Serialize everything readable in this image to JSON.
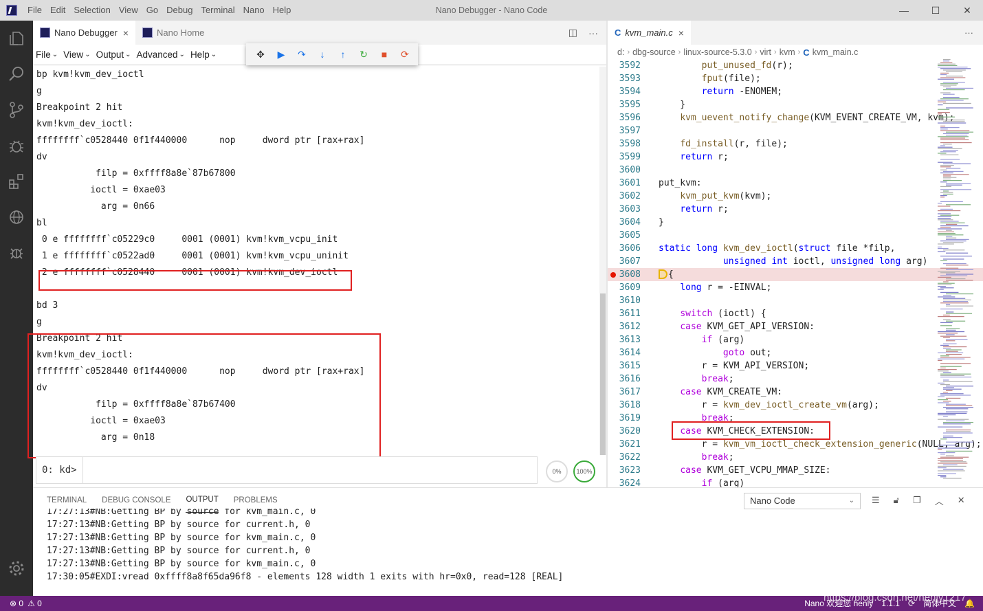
{
  "window": {
    "title": "Nano Debugger - Nano Code",
    "menus": [
      "File",
      "Edit",
      "Selection",
      "View",
      "Go",
      "Debug",
      "Terminal",
      "Nano",
      "Help"
    ]
  },
  "left_editor": {
    "tabs": [
      {
        "label": "Nano Debugger",
        "close": "×"
      },
      {
        "label": "Nano Home"
      }
    ],
    "actions": {
      "split": "◫",
      "more": "···"
    },
    "menu": [
      "File",
      "View",
      "Output",
      "Advanced",
      "Help"
    ],
    "debug_toolbar": [
      {
        "name": "drag",
        "glyph": "✥",
        "color": "#333333"
      },
      {
        "name": "continue",
        "glyph": "▶",
        "color": "#1a73e8"
      },
      {
        "name": "step-over",
        "glyph": "↷",
        "color": "#1a73e8"
      },
      {
        "name": "step-into",
        "glyph": "↓",
        "color": "#1a73e8"
      },
      {
        "name": "step-out",
        "glyph": "↑",
        "color": "#1a73e8"
      },
      {
        "name": "restart",
        "glyph": "↻",
        "color": "#3aaa3a"
      },
      {
        "name": "stop",
        "glyph": "■",
        "color": "#e0502c"
      },
      {
        "name": "disconnect",
        "glyph": "⟳",
        "color": "#e0502c"
      }
    ],
    "console_lines": [
      "bp kvm!kvm_dev_ioctl",
      "g",
      "Breakpoint 2 hit",
      "kvm!kvm_dev_ioctl:",
      "ffffffff`c0528440 0f1f440000      nop     dword ptr [rax+rax]",
      "dv",
      "           filp = 0xffff8a8e`87b67800",
      "          ioctl = 0xae03",
      "            arg = 0n66",
      "bl",
      " 0 e ffffffff`c05229c0     0001 (0001) kvm!kvm_vcpu_init",
      " 1 e ffffffff`c0522ad0     0001 (0001) kvm!kvm_vcpu_uninit",
      " 2 e ffffffff`c0528440     0001 (0001) kvm!kvm_dev_ioctl",
      "",
      "bd 3",
      "g",
      "Breakpoint 2 hit",
      "kvm!kvm_dev_ioctl:",
      "ffffffff`c0528440 0f1f440000      nop     dword ptr [rax+rax]",
      "dv",
      "           filp = 0xffff8a8e`87b67400",
      "          ioctl = 0xae03",
      "            arg = 0n18"
    ],
    "command": {
      "prompt": "0: kd>",
      "value": ""
    },
    "gauges": [
      {
        "label": "0%",
        "level": 0
      },
      {
        "label": "100%",
        "level": 100
      }
    ]
  },
  "right_editor": {
    "tab": {
      "label": "kvm_main.c",
      "icon": "C",
      "close": "×"
    },
    "more": "···",
    "breadcrumbs": [
      "d:",
      "dbg-source",
      "linux-source-5.3.0",
      "virt",
      "kvm",
      "kvm_main.c"
    ],
    "breakpoint_line": 3608,
    "code_lines": [
      {
        "n": "3592",
        "t": "        put_unused_fd(r);"
      },
      {
        "n": "3593",
        "t": "        fput(file);"
      },
      {
        "n": "3594",
        "t": "        return -ENOMEM;"
      },
      {
        "n": "3595",
        "t": "    }"
      },
      {
        "n": "3596",
        "t": "    kvm_uevent_notify_change(KVM_EVENT_CREATE_VM, kvm);"
      },
      {
        "n": "3597",
        "t": ""
      },
      {
        "n": "3598",
        "t": "    fd_install(r, file);"
      },
      {
        "n": "3599",
        "t": "    return r;"
      },
      {
        "n": "3600",
        "t": ""
      },
      {
        "n": "3601",
        "t": "put_kvm:"
      },
      {
        "n": "3602",
        "t": "    kvm_put_kvm(kvm);"
      },
      {
        "n": "3603",
        "t": "    return r;"
      },
      {
        "n": "3604",
        "t": "}"
      },
      {
        "n": "3605",
        "t": ""
      },
      {
        "n": "3606",
        "t": "static long kvm_dev_ioctl(struct file *filp,"
      },
      {
        "n": "3607",
        "t": "            unsigned int ioctl, unsigned long arg)"
      },
      {
        "n": "3608",
        "t": "{"
      },
      {
        "n": "3609",
        "t": "    long r = -EINVAL;"
      },
      {
        "n": "3610",
        "t": ""
      },
      {
        "n": "3611",
        "t": "    switch (ioctl) {"
      },
      {
        "n": "3612",
        "t": "    case KVM_GET_API_VERSION:"
      },
      {
        "n": "3613",
        "t": "        if (arg)"
      },
      {
        "n": "3614",
        "t": "            goto out;"
      },
      {
        "n": "3615",
        "t": "        r = KVM_API_VERSION;"
      },
      {
        "n": "3616",
        "t": "        break;"
      },
      {
        "n": "3617",
        "t": "    case KVM_CREATE_VM:"
      },
      {
        "n": "3618",
        "t": "        r = kvm_dev_ioctl_create_vm(arg);"
      },
      {
        "n": "3619",
        "t": "        break;"
      },
      {
        "n": "3620",
        "t": "    case KVM_CHECK_EXTENSION:"
      },
      {
        "n": "3621",
        "t": "        r = kvm_vm_ioctl_check_extension_generic(NULL, arg);"
      },
      {
        "n": "3622",
        "t": "        break;"
      },
      {
        "n": "3623",
        "t": "    case KVM_GET_VCPU_MMAP_SIZE:"
      },
      {
        "n": "3624",
        "t": "        if (arg)"
      }
    ]
  },
  "panel": {
    "tabs": [
      "TERMINAL",
      "DEBUG CONSOLE",
      "OUTPUT",
      "PROBLEMS"
    ],
    "active_tab": "OUTPUT",
    "channel": "Nano Code",
    "output_lines": [
      "17:27:13#NB:Getting BP by source for kvm_main.c, 0",
      "17:27:13#NB:Getting BP by source for current.h, 0",
      "17:27:13#NB:Getting BP by source for kvm_main.c, 0",
      "17:27:13#NB:Getting BP by source for current.h, 0",
      "17:27:13#NB:Getting BP by source for kvm_main.c, 0",
      "17:30:05#EXDI:vread 0xffff8a8f65da96f8 - elements 128 width 1 exits with hr=0x0, read=128 [REAL]"
    ]
  },
  "statusbar": {
    "errors": "⊗ 0",
    "warnings": "⚠ 0",
    "greeting": "Nano 欢迎您 henly",
    "version": "1.1.1",
    "sync": "⟳",
    "language": "简体中文",
    "bell": "🔔"
  },
  "watermark": "https://blog.csdn.net/henly1217",
  "colors": {
    "statusbar": "#68217a",
    "activitybar": "#2c2c2c",
    "highlight_box": "#e02020",
    "breakpoint": "#e51400"
  }
}
